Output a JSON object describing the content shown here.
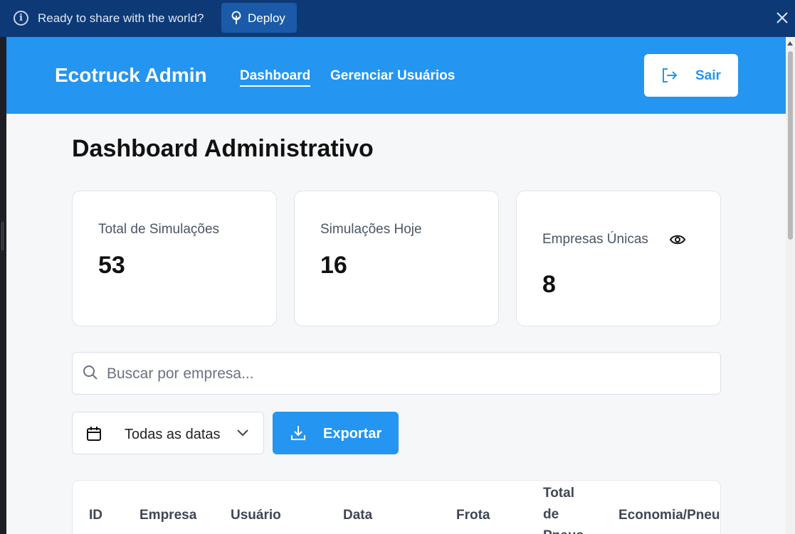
{
  "banner": {
    "message": "Ready to share with the world?",
    "deploy_label": "Deploy",
    "colors": {
      "background": "#0d3a77",
      "button": "#1a5aa8"
    }
  },
  "header": {
    "brand": "Ecotruck Admin",
    "nav": [
      {
        "label": "Dashboard",
        "active": true
      },
      {
        "label": "Gerenciar Usuários",
        "active": false
      }
    ],
    "logout_label": "Sair",
    "colors": {
      "background": "#2495f0",
      "accent": "#2495f0"
    }
  },
  "page": {
    "title": "Dashboard Administrativo"
  },
  "stats": [
    {
      "label": "Total de Simulações",
      "value": "53"
    },
    {
      "label": "Simulações Hoje",
      "value": "16"
    },
    {
      "label": "Empresas Únicas",
      "value": "8",
      "icon": "eye-icon"
    }
  ],
  "filters": {
    "search_placeholder": "Buscar por empresa...",
    "search_value": "",
    "date_selected": "Todas as datas",
    "export_label": "Exportar"
  },
  "table": {
    "columns": [
      "ID",
      "Empresa",
      "Usuário",
      "Data",
      "Frota",
      "Total de Pneus",
      "Economia/Pneu"
    ]
  }
}
